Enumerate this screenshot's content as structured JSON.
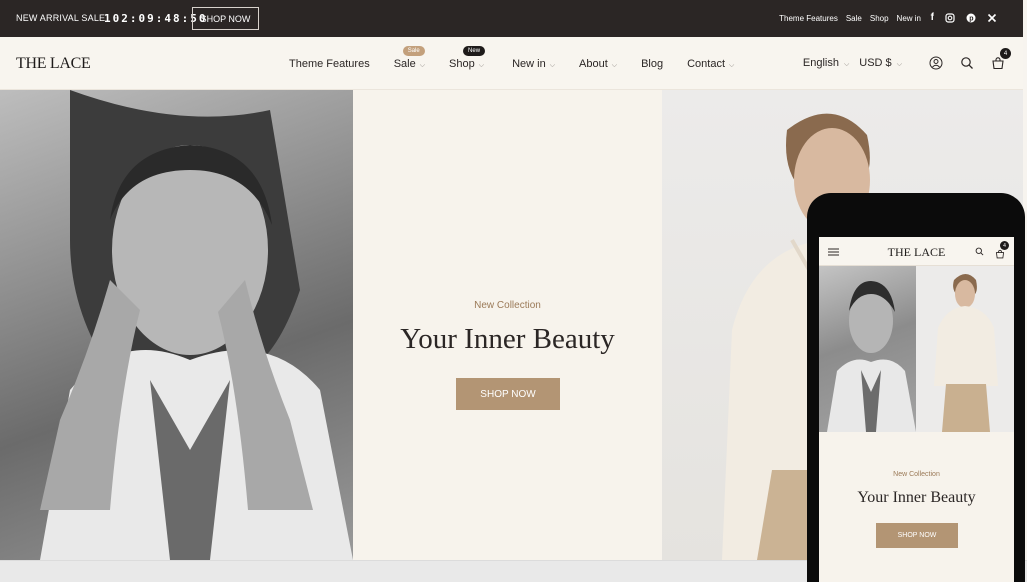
{
  "announcement": {
    "promo_text": "NEW ARRIVAL SALE",
    "countdown": "102:09:48:50",
    "shop_now_label": "SHOP NOW",
    "links": [
      "Theme Features",
      "Sale",
      "Shop",
      "New in"
    ],
    "socials": [
      "facebook-icon",
      "instagram-icon",
      "pinterest-icon",
      "x-icon"
    ]
  },
  "header": {
    "logo": "THE LACE",
    "menu": [
      {
        "label": "Theme Features",
        "dropdown": false
      },
      {
        "label": "Sale",
        "dropdown": true,
        "badge": "Sale"
      },
      {
        "label": "Shop",
        "dropdown": true,
        "badge": "New"
      },
      {
        "label": "New in",
        "dropdown": true
      },
      {
        "label": "About",
        "dropdown": true
      },
      {
        "label": "Blog",
        "dropdown": false
      },
      {
        "label": "Contact",
        "dropdown": true
      }
    ],
    "language": "English",
    "currency": "USD $",
    "cart_count": "4"
  },
  "hero": {
    "eyebrow": "New Collection",
    "headline": "Your Inner Beauty",
    "cta_label": "SHOP NOW"
  },
  "mobile": {
    "logo": "THE LACE",
    "cart_count": "4",
    "eyebrow": "New Collection",
    "headline": "Your Inner Beauty",
    "cta_label": "SHOP NOW"
  },
  "colors": {
    "topbar": "#2b2625",
    "accent": "#b39574",
    "eyebrow": "#9b7a58",
    "page_bg": "#f7f4ef"
  }
}
